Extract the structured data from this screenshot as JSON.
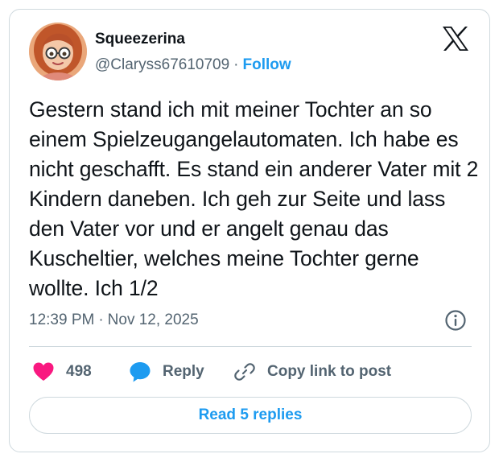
{
  "tweet": {
    "author_name": "Squeezerina",
    "handle": "@Claryss67610709",
    "separator": "·",
    "follow_label": "Follow",
    "text": "Gestern stand ich mit meiner Tochter an so einem Spielzeugangelautomaten. Ich habe es nicht geschafft. Es stand ein anderer Vater mit 2 Kindern daneben. Ich geh zur Seite und lass den Vater vor und er angelt genau das Kuscheltier, welches meine Tochter gerne wollte. Ich 1/2",
    "time": "12:39 PM",
    "date": "Nov 12, 2025"
  },
  "actions": {
    "like_count": "498",
    "reply_label": "Reply",
    "copy_label": "Copy link to post"
  },
  "footer": {
    "read_replies_label": "Read 5 replies"
  },
  "colors": {
    "accent": "#1d9bf0",
    "like": "#f91880",
    "text": "#0f1419",
    "muted": "#536471",
    "border": "#cfd9de"
  },
  "icons": [
    "x-logo-icon",
    "info-icon",
    "heart-icon",
    "reply-bubble-icon",
    "link-icon"
  ]
}
